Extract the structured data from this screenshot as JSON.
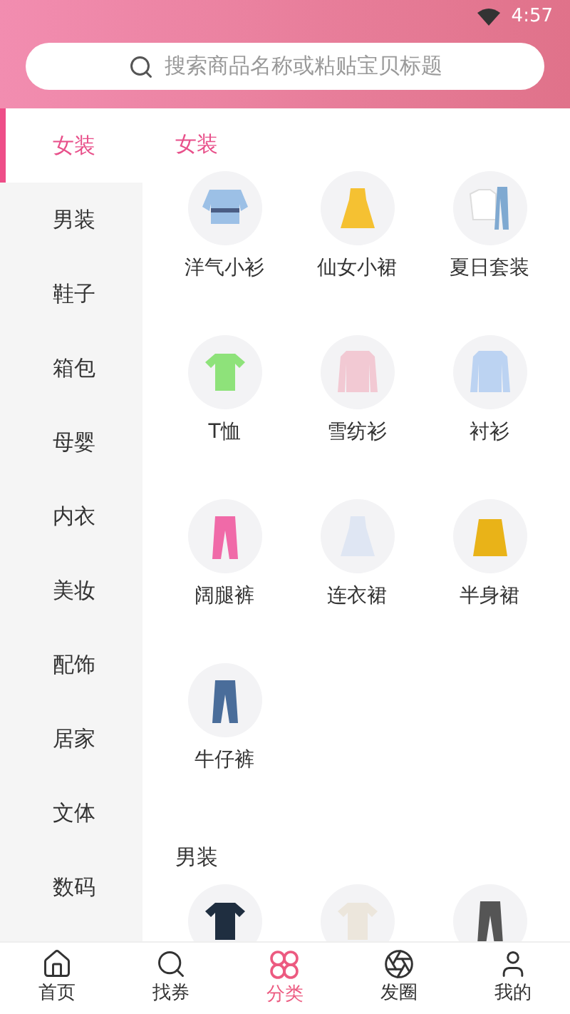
{
  "status_bar": {
    "time": "4:57"
  },
  "search": {
    "placeholder": "搜索商品名称或粘贴宝贝标题"
  },
  "sidebar": {
    "items": [
      {
        "label": "女装",
        "selected": true
      },
      {
        "label": "男装",
        "selected": false
      },
      {
        "label": "鞋子",
        "selected": false
      },
      {
        "label": "箱包",
        "selected": false
      },
      {
        "label": "母婴",
        "selected": false
      },
      {
        "label": "内衣",
        "selected": false
      },
      {
        "label": "美妆",
        "selected": false
      },
      {
        "label": "配饰",
        "selected": false
      },
      {
        "label": "居家",
        "selected": false
      },
      {
        "label": "文体",
        "selected": false
      },
      {
        "label": "数码",
        "selected": false
      }
    ]
  },
  "sections": [
    {
      "title": "女装",
      "items": [
        {
          "kind": "picture",
          "label": "洋气小衫"
        },
        {
          "kind": "picture",
          "label": "仙女小裙"
        },
        {
          "kind": "picture",
          "label": "夏日套装"
        },
        {
          "kind": "picture",
          "label": "T恤"
        },
        {
          "kind": "picture",
          "label": "雪纺衫"
        },
        {
          "kind": "picture",
          "label": "衬衫"
        },
        {
          "kind": "picture",
          "label": "阔腿裤"
        },
        {
          "kind": "picture",
          "label": "连衣裙"
        },
        {
          "kind": "picture",
          "label": "半身裙"
        },
        {
          "kind": "picture",
          "label": "牛仔裤"
        }
      ]
    },
    {
      "title": "男装"
    }
  ],
  "tab_bar": [
    {
      "label": "首页",
      "selected": false
    },
    {
      "label": "找券",
      "selected": false
    },
    {
      "label": "分类",
      "selected": true
    },
    {
      "label": "发圈",
      "selected": false
    },
    {
      "label": "我的",
      "selected": false
    }
  ]
}
